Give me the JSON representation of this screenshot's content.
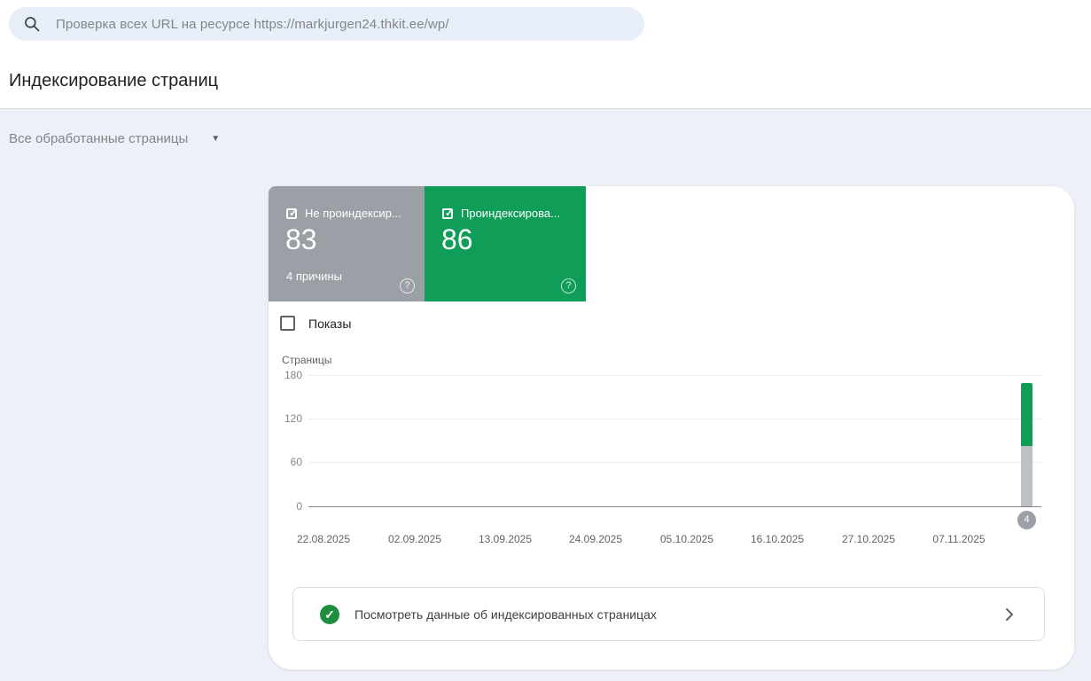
{
  "search": {
    "query": "Проверка всех URL на ресурсе https://markjurgen24.thkit.ee/wp/"
  },
  "page": {
    "title": "Индексирование страниц"
  },
  "filter": {
    "selected": "Все обработанные страницы"
  },
  "stat_cards": [
    {
      "label": "Не проиндексир...",
      "value": "83",
      "subtext": "4 причины",
      "color": "#9aa0a6",
      "checked": true
    },
    {
      "label": "Проиндексирова...",
      "value": "86",
      "subtext": "",
      "color": "#0f9d58",
      "checked": true
    }
  ],
  "impressions": {
    "label": "Показы",
    "checked": false
  },
  "chart_data": {
    "type": "bar",
    "stacked": true,
    "title": "",
    "ylabel": "Страницы",
    "xlabel": "",
    "ylim": [
      0,
      180
    ],
    "y_ticks": [
      180,
      120,
      60,
      0
    ],
    "x_tick_labels": [
      "22.08.2025",
      "02.09.2025",
      "13.09.2025",
      "24.09.2025",
      "05.10.2025",
      "16.10.2025",
      "27.10.2025",
      "07.11.2025"
    ],
    "grid": true,
    "legend": "none",
    "series": [
      {
        "name": "Проиндексированы",
        "color": "#0f9d58",
        "values": [
          86
        ]
      },
      {
        "name": "Не проиндексированы",
        "color": "#bdc1c6",
        "values": [
          83
        ]
      }
    ],
    "data_note": "single stacked bar at far right of plot, past the 07.11.2025 tick; green (86) on top, gray (83) below",
    "point_badge": "4"
  },
  "banner": {
    "text": "Посмотреть данные об индексированных страницах"
  },
  "icons": {
    "check": "✓",
    "help": "?",
    "dropdown_arrow": "▼"
  }
}
